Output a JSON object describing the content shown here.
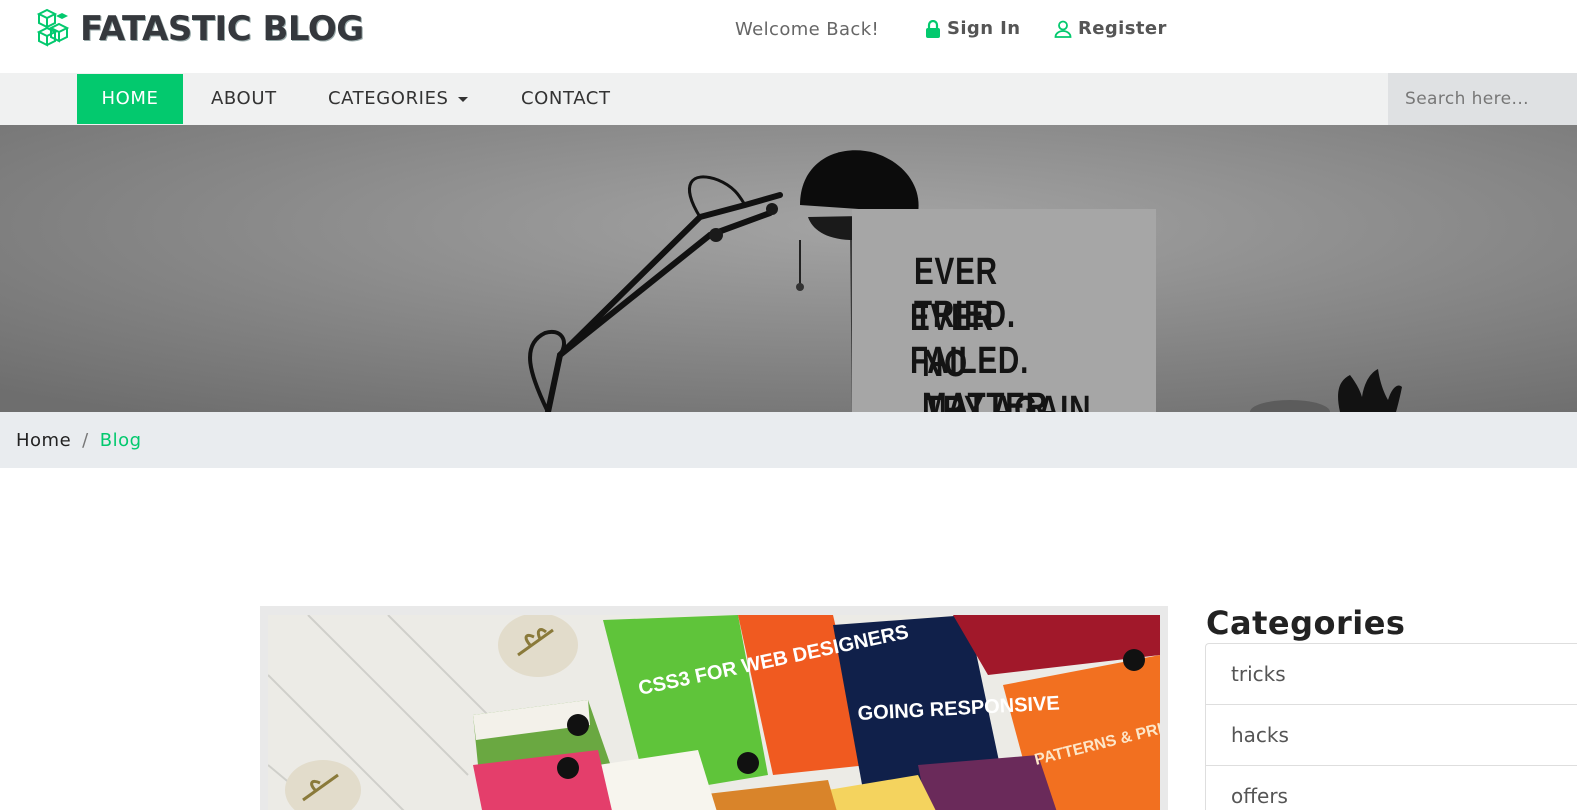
{
  "header": {
    "brand": "FATASTIC BLOG",
    "welcome": "Welcome Back!",
    "sign_in": "Sign In",
    "register": "Register"
  },
  "nav": {
    "items": [
      {
        "label": "HOME",
        "active": true
      },
      {
        "label": "ABOUT"
      },
      {
        "label": "CATEGORIES",
        "dropdown": true
      },
      {
        "label": "CONTACT"
      }
    ],
    "search_placeholder": "Search here..."
  },
  "hero": {
    "poster_lines": [
      "EVER TRIED.",
      "EVER FAILED.",
      "NO MATTER.",
      "TRY AGAIN."
    ]
  },
  "breadcrumb": {
    "home": "Home",
    "separator": "/",
    "active": "Blog"
  },
  "post": {
    "book_titles": [
      "CSS3 FOR WEB DESIGNERS",
      "GOING RESPONSIVE",
      "PATTERNS & PRINCIPLES"
    ]
  },
  "sidebar": {
    "title": "Categories",
    "categories": [
      "tricks",
      "hacks",
      "offers"
    ]
  },
  "colors": {
    "accent": "#03c96e",
    "nav_bg": "#f0f1f1",
    "breadcrumb_bg": "#e9ecef"
  }
}
